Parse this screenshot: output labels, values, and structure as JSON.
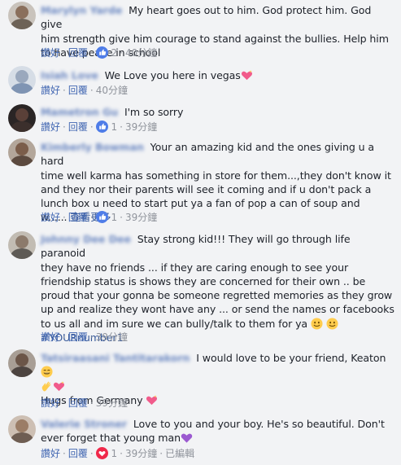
{
  "labels": {
    "like": "讚好",
    "reply": "回覆",
    "edited": "已編輯"
  },
  "comments": [
    {
      "author": "Marylyn Yarde",
      "text": "My heart goes out to him. God protect him. God give\nhim strength give him courage to stand against the bullies. Help him\nto have peace in school",
      "reactions": "2",
      "time": "40分鐘"
    },
    {
      "author": "Isiah Love",
      "text": "We Love you here in vegas",
      "time": "40分鐘"
    },
    {
      "author": "Mametron Gu",
      "text": "I'm so sorry",
      "reactions": "1",
      "time": "39分鐘"
    },
    {
      "author": "Kimberly Bowman",
      "text": "Your an amazing kid and the ones giving u a hard\ntime well karma has something in store for them...,they don't know it\nand they nor their parents will see it coming and if u don't pack a\nlunch box u need to start put ya a fan of pop a can of soup and\nw...... ",
      "see_more": "查看更多",
      "reactions": "1",
      "time": "39分鐘"
    },
    {
      "author": "Johnny Dee Dee",
      "text": "Stay strong kid!!! They will go through life paranoid\nthey have no friends ... if they are caring enough to see your\nfriendship status is shows they are concerned for their own .. be\nproud that your gonna be someone regretted memories as they grow\nup and realize they wont have any ... or send the names or facebooks\nto us all and im sure we can bully/talk to them for ya ",
      "hashtag": "#YOURnumber1",
      "time": "39分鐘"
    },
    {
      "author": "Tatsiraasani Tantitarakorn",
      "text": "I would love to be your friend, Keaton ",
      "text2": "Hugs from Germany ",
      "time": "39分鐘"
    },
    {
      "author": "Valerie Stroner",
      "text": "Love to you and your boy. He's so beautiful. Don't\never forget that young man",
      "reactions": "1",
      "time": "39分鐘"
    }
  ]
}
